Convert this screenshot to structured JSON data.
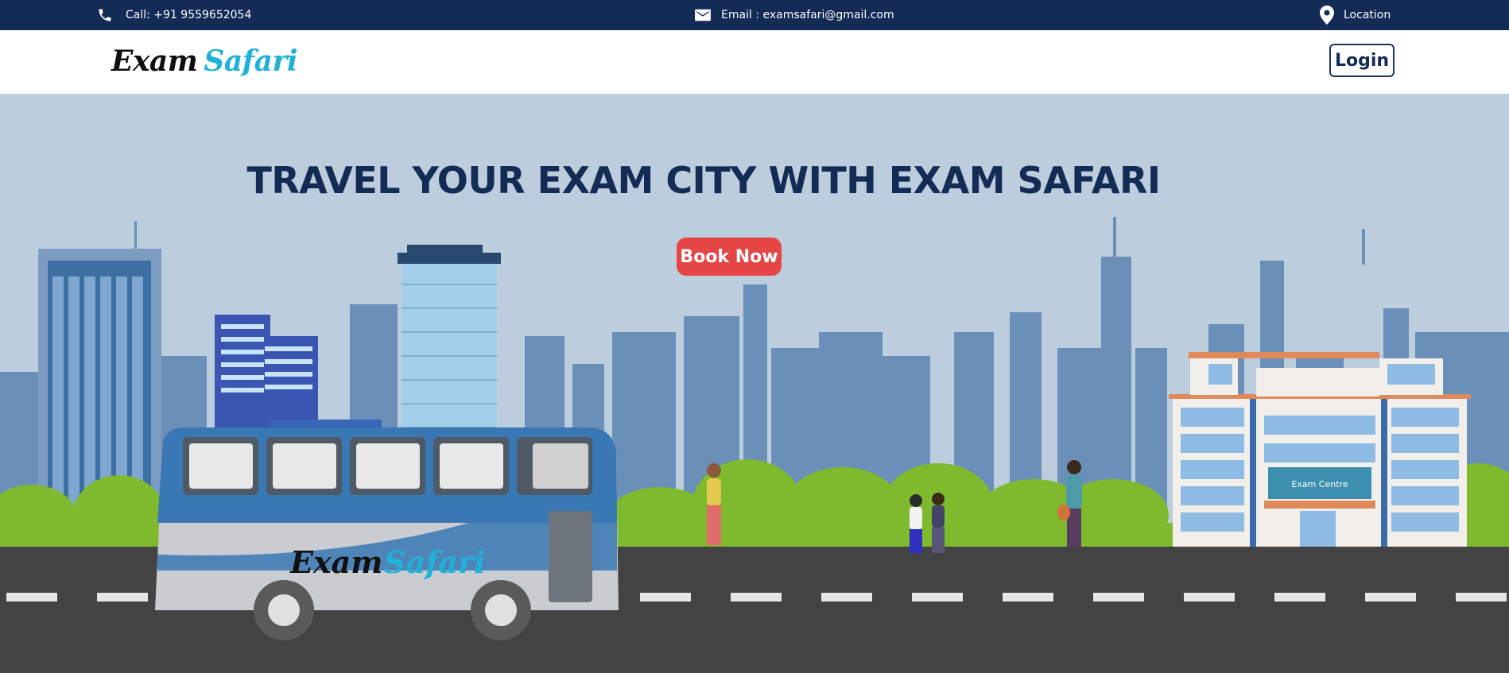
{
  "topbar": {
    "phone_label": "Call: +91 9559652054",
    "email_label": "Email : examsafari@gmail.com",
    "location_label": "Location",
    "icons": {
      "phone": "phone-icon",
      "email": "envelope-icon",
      "location": "map-pin-icon"
    }
  },
  "navbar": {
    "logo_word1": "Exam",
    "logo_word2": "Safari",
    "login_label": "Login"
  },
  "hero": {
    "title": "TRAVEL YOUR EXAM CITY WITH EXAM SAFARI",
    "book_label": "Book Now",
    "bus_logo_word1": "Exam",
    "bus_logo_word2": "Safari",
    "building_sign": "Exam Centre"
  },
  "colors": {
    "topbar_bg": "#132b55",
    "brand_cyan": "#20b2d6",
    "cta_red": "#e64545",
    "sky": "#bccddd",
    "road": "#434343"
  }
}
